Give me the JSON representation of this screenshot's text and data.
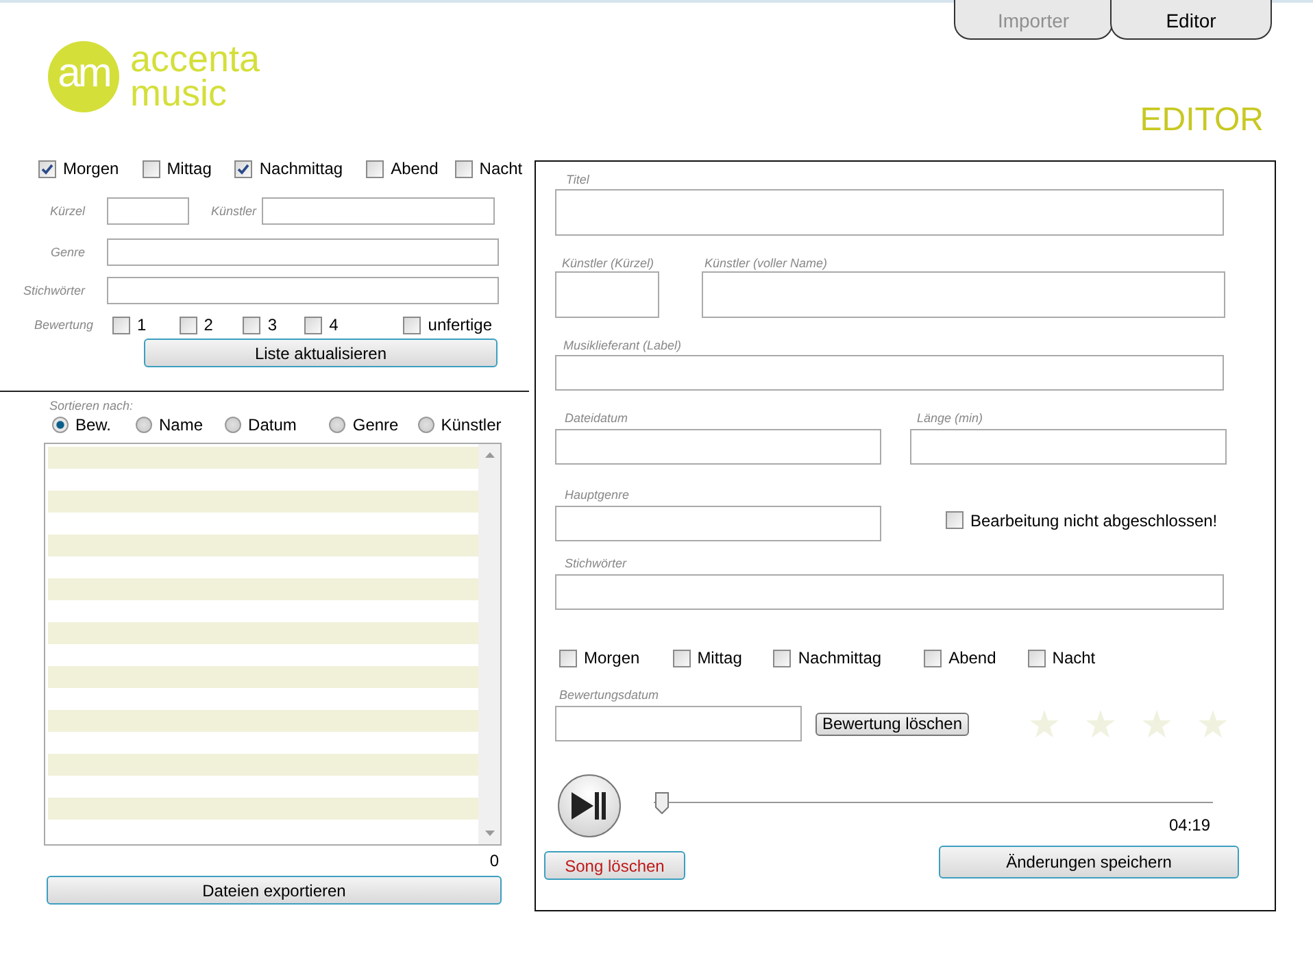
{
  "logo": {
    "mark": "am",
    "lines": [
      "accenta",
      "music"
    ]
  },
  "tabs": [
    {
      "label": "Importer",
      "selected": false
    },
    {
      "label": "Editor",
      "selected": true
    }
  ],
  "page_title": "EDITOR",
  "filter": {
    "times": [
      {
        "label": "Morgen",
        "checked": true
      },
      {
        "label": "Mittag",
        "checked": false
      },
      {
        "label": "Nachmittag",
        "checked": true
      },
      {
        "label": "Abend",
        "checked": false
      },
      {
        "label": "Nacht",
        "checked": false
      }
    ],
    "short_label": "Kürzel",
    "artist_label": "Künstler",
    "genre_label": "Genre",
    "keywords_label": "Stichwörter",
    "rating_label": "Bewertung",
    "ratings": [
      {
        "label": "1",
        "checked": false
      },
      {
        "label": "2",
        "checked": false
      },
      {
        "label": "3",
        "checked": false
      },
      {
        "label": "4",
        "checked": false
      }
    ],
    "unfinished": {
      "label": "unfertige",
      "checked": false
    },
    "button": "Liste aktualisieren"
  },
  "sort": {
    "label": "Sortieren nach:",
    "options": [
      {
        "label": "Bew.",
        "selected": true
      },
      {
        "label": "Name",
        "selected": false
      },
      {
        "label": "Datum",
        "selected": false
      },
      {
        "label": "Genre",
        "selected": false
      },
      {
        "label": "Künstler",
        "selected": false
      }
    ]
  },
  "list": {
    "count": "0",
    "export_button": "Dateien exportieren"
  },
  "editor": {
    "title_label": "Titel",
    "artist_short_label": "Künstler (Kürzel)",
    "artist_full_label": "Künstler (voller Name)",
    "label_label": "Musiklieferant (Label)",
    "file_date_label": "Dateidatum",
    "length_label": "Länge (min)",
    "genre_label": "Hauptgenre",
    "unfinished": {
      "label": "Bearbeitung nicht abgeschlossen!",
      "checked": false
    },
    "keywords_label": "Stichwörter",
    "times": [
      {
        "label": "Morgen",
        "checked": false
      },
      {
        "label": "Mittag",
        "checked": false
      },
      {
        "label": "Nachmittag",
        "checked": false
      },
      {
        "label": "Abend",
        "checked": false
      },
      {
        "label": "Nacht",
        "checked": false
      }
    ],
    "rating_date_label": "Bewertungsdatum",
    "clear_rating_button": "Bewertung löschen",
    "stars": 0
  },
  "player": {
    "level": 0,
    "duration": "04:19"
  },
  "delete_button": "Song löschen",
  "save_button": "Änderungen speichern"
}
